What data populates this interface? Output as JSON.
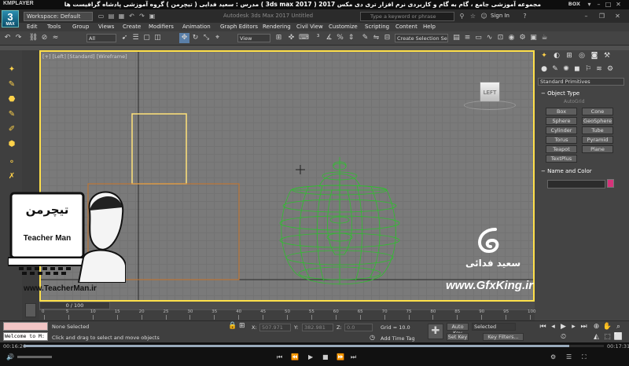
{
  "player": {
    "logo": "KMPLAYER",
    "title": "مجموعه آموزشی جامع ، گام به گام و کاربردی نرم افزار تری دی مکس 2017 ( 3ds max 2017 )  مدرس : سعید فدایی ( تیچرمن ) گروه آموزشی پادشاه گرافیست ها",
    "box_label": "BOX",
    "time_current": "00:16:26",
    "time_total": "00:17:31",
    "progress": 0.94
  },
  "app": {
    "logo_digit": "3",
    "logo_sub": "MAX",
    "workspace": "Workspace: Default",
    "title": "Autodesk 3ds Max 2017     Untitled",
    "search_placeholder": "Type a keyword or phrase",
    "signin": "Sign In"
  },
  "menu": [
    "Edit",
    "Tools",
    "Group",
    "Views",
    "Create",
    "Modifiers",
    "Animation",
    "Graph Editors",
    "Rendering",
    "Civil View",
    "Customize",
    "Scripting",
    "Content",
    "Help"
  ],
  "toolbar": {
    "filter": "All",
    "refcoord": "View",
    "selection_set": "Create Selection Se"
  },
  "viewport": {
    "label": "[+] [Left] [Standard] [Wireframe]",
    "viewcube": "LEFT"
  },
  "command_panel": {
    "category": "Standard Primitives",
    "object_type": "Object Type",
    "autogrid": "AutoGrid",
    "objects": [
      "Box",
      "Cone",
      "Sphere",
      "GeoSphere",
      "Cylinder",
      "Tube",
      "Torus",
      "Pyramid",
      "Teapot",
      "Plane",
      "TextPlus"
    ],
    "name_color": "Name and Color",
    "object_color": "#d6337a"
  },
  "timeline": {
    "frame": "0 / 100",
    "ticks": [
      "0",
      "5",
      "10",
      "15",
      "20",
      "25",
      "30",
      "35",
      "40",
      "45",
      "50",
      "55",
      "60",
      "65",
      "70",
      "75",
      "80",
      "85",
      "90",
      "95",
      "100"
    ]
  },
  "status": {
    "maxscript": "Welcome to M:",
    "selected": "None Selected",
    "prompt": "Click and drag to select and move objects",
    "x_label": "X:",
    "x_value": "507.971",
    "y_label": "Y:",
    "y_value": "382.981",
    "z_label": "Z:",
    "z_value": "0.0",
    "grid": "Grid = 10.0",
    "add_time_tag": "Add Time Tag",
    "auto_key": "Auto Key",
    "set_key": "Set Key",
    "selected_dd": "Selected",
    "key_filters": "Key Filters..."
  },
  "watermark": {
    "teacherman_brand": "Teacher Man",
    "teacherman_url": "www.TeacherMan.ir",
    "gfx_url": "www.GfxKing.ir",
    "gfx_name": "سعید فدائی"
  }
}
